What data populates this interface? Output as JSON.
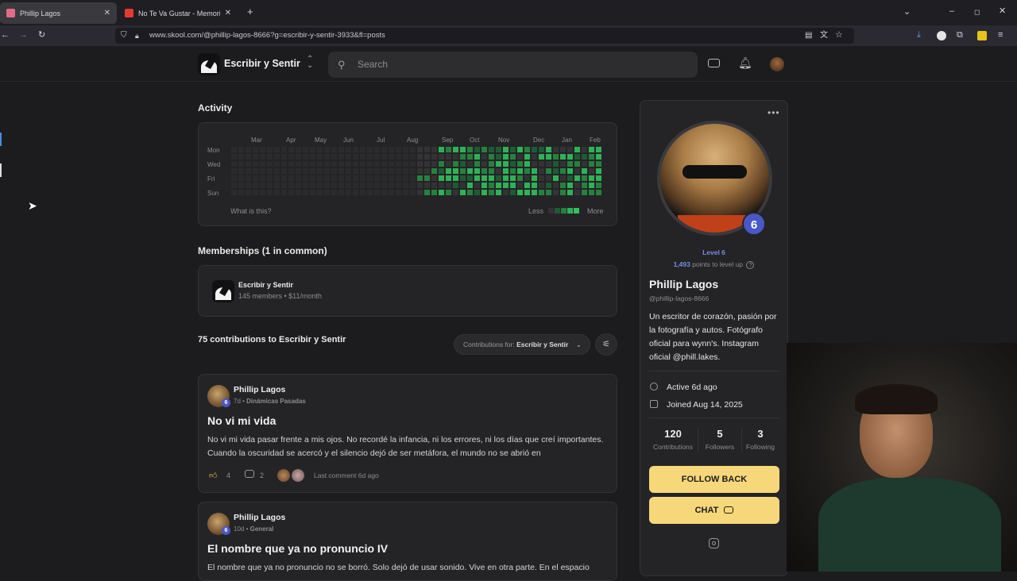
{
  "browser": {
    "tabs": [
      {
        "title": "Phillip Lagos",
        "active": true,
        "favicon_color": "#e06c8a"
      },
      {
        "title": "No Te Va Gustar - Memorias de",
        "active": false,
        "favicon_color": "#e53935"
      }
    ],
    "url": "www.skool.com/@phillip-lagos-8666?g=escribir-y-sentir-3933&fl=posts"
  },
  "header": {
    "community_name": "Escribir y Sentir",
    "search_placeholder": "Search"
  },
  "activity": {
    "title": "Activity",
    "months": [
      "Mar",
      "Apr",
      "May",
      "Jun",
      "Jul",
      "Aug",
      "Sep",
      "Oct",
      "Nov",
      "Dec",
      "Jan",
      "Feb"
    ],
    "days": [
      "Mon",
      "Wed",
      "Fri",
      "Sun"
    ],
    "help_link": "What is this?",
    "legend_less": "Less",
    "legend_more": "More",
    "colors": {
      "empty": "#333336",
      "l1": "#1e5a34",
      "l2": "#27803f",
      "l3": "#2fb157"
    }
  },
  "memberships": {
    "title": "Memberships (1 in common)",
    "group_name": "Escribir y Sentir",
    "group_meta": "145 members • $11/month"
  },
  "contributions": {
    "title": "75 contributions to Escribir y Sentir",
    "filter_prefix": "Contributions for: ",
    "filter_value": "Escribir y Sentir"
  },
  "posts": [
    {
      "author": "Phillip Lagos",
      "level": "6",
      "meta_time": "7d",
      "meta_category": "Dinámicas Pasadas",
      "title": "No vi mi vida",
      "body": "No vi mi vida pasar frente a mis ojos. No recordé la infancia, ni los errores, ni los días que creí importantes. Cuando la oscuridad se acercó y el silencio dejó de ser metáfora, el mundo no se abrió en",
      "likes": "4",
      "comments": "2",
      "last_comment": "Last comment 6d ago"
    },
    {
      "author": "Phillip Lagos",
      "level": "6",
      "meta_time": "10d",
      "meta_category": "General",
      "title": "El nombre que ya no pronuncio IV",
      "body": "El nombre que ya no pronuncio no se borró. Solo dejó de usar sonido. Vive en otra parte. En el espacio"
    }
  ],
  "profile": {
    "level_badge": "6",
    "level_label": "Level 6",
    "points": "1,493",
    "points_suffix": " points to level up",
    "name": "Phillip Lagos",
    "handle": "@phillip-lagos-8666",
    "bio": "Un escritor de corazón, pasión por la fotografía y autos. Fotógrafo oficial para wynn's. Instagram oficial @phill.lakes.",
    "active": "Active 6d ago",
    "joined": "Joined Aug 14, 2025",
    "stats": [
      {
        "value": "120",
        "label": "Contributions"
      },
      {
        "value": "5",
        "label": "Followers"
      },
      {
        "value": "3",
        "label": "Following"
      }
    ],
    "follow_label": "FOLLOW BACK",
    "chat_label": "CHAT",
    "accent": "#f6d77a",
    "level_color": "#4a57c6"
  }
}
